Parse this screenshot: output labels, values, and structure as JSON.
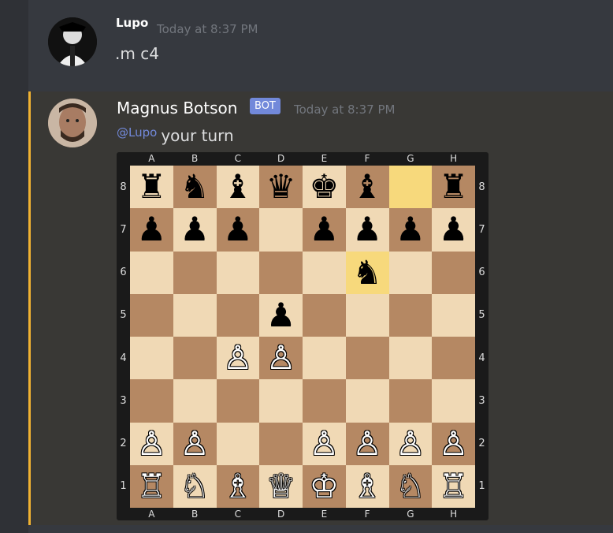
{
  "messages": [
    {
      "username": "Lupo",
      "timestamp": "Today at 8:37 PM",
      "content": ".m c4"
    },
    {
      "username": "Magnus Botson",
      "badge": "BOT",
      "timestamp": "Today at 8:37 PM",
      "mention": "@Lupo",
      "content": "your turn"
    }
  ],
  "board": {
    "files": [
      "A",
      "B",
      "C",
      "D",
      "E",
      "F",
      "G",
      "H"
    ],
    "ranks": [
      "8",
      "7",
      "6",
      "5",
      "4",
      "3",
      "2",
      "1"
    ],
    "light_color": "#f0d9b5",
    "dark_color": "#b58863",
    "highlight_color": "#f7d97c",
    "highlighted_squares": [
      "g8",
      "f6"
    ],
    "pieces": {
      "a8": "bR",
      "b8": "bN",
      "c8": "bB",
      "d8": "bQ",
      "e8": "bK",
      "f8": "bB",
      "h8": "bR",
      "a7": "bP",
      "b7": "bP",
      "c7": "bP",
      "e7": "bP",
      "f7": "bP",
      "g7": "bP",
      "h7": "bP",
      "f6": "bN",
      "d5": "bP",
      "c4": "wP",
      "d4": "wP",
      "a2": "wP",
      "b2": "wP",
      "e2": "wP",
      "f2": "wP",
      "g2": "wP",
      "h2": "wP",
      "a1": "wR",
      "b1": "wN",
      "c1": "wB",
      "d1": "wQ",
      "e1": "wK",
      "f1": "wB",
      "g1": "wN",
      "h1": "wR"
    }
  },
  "colors": {
    "accent_bar": "#f0b232",
    "mention": "#7289da",
    "bot_badge": "#7289da"
  }
}
